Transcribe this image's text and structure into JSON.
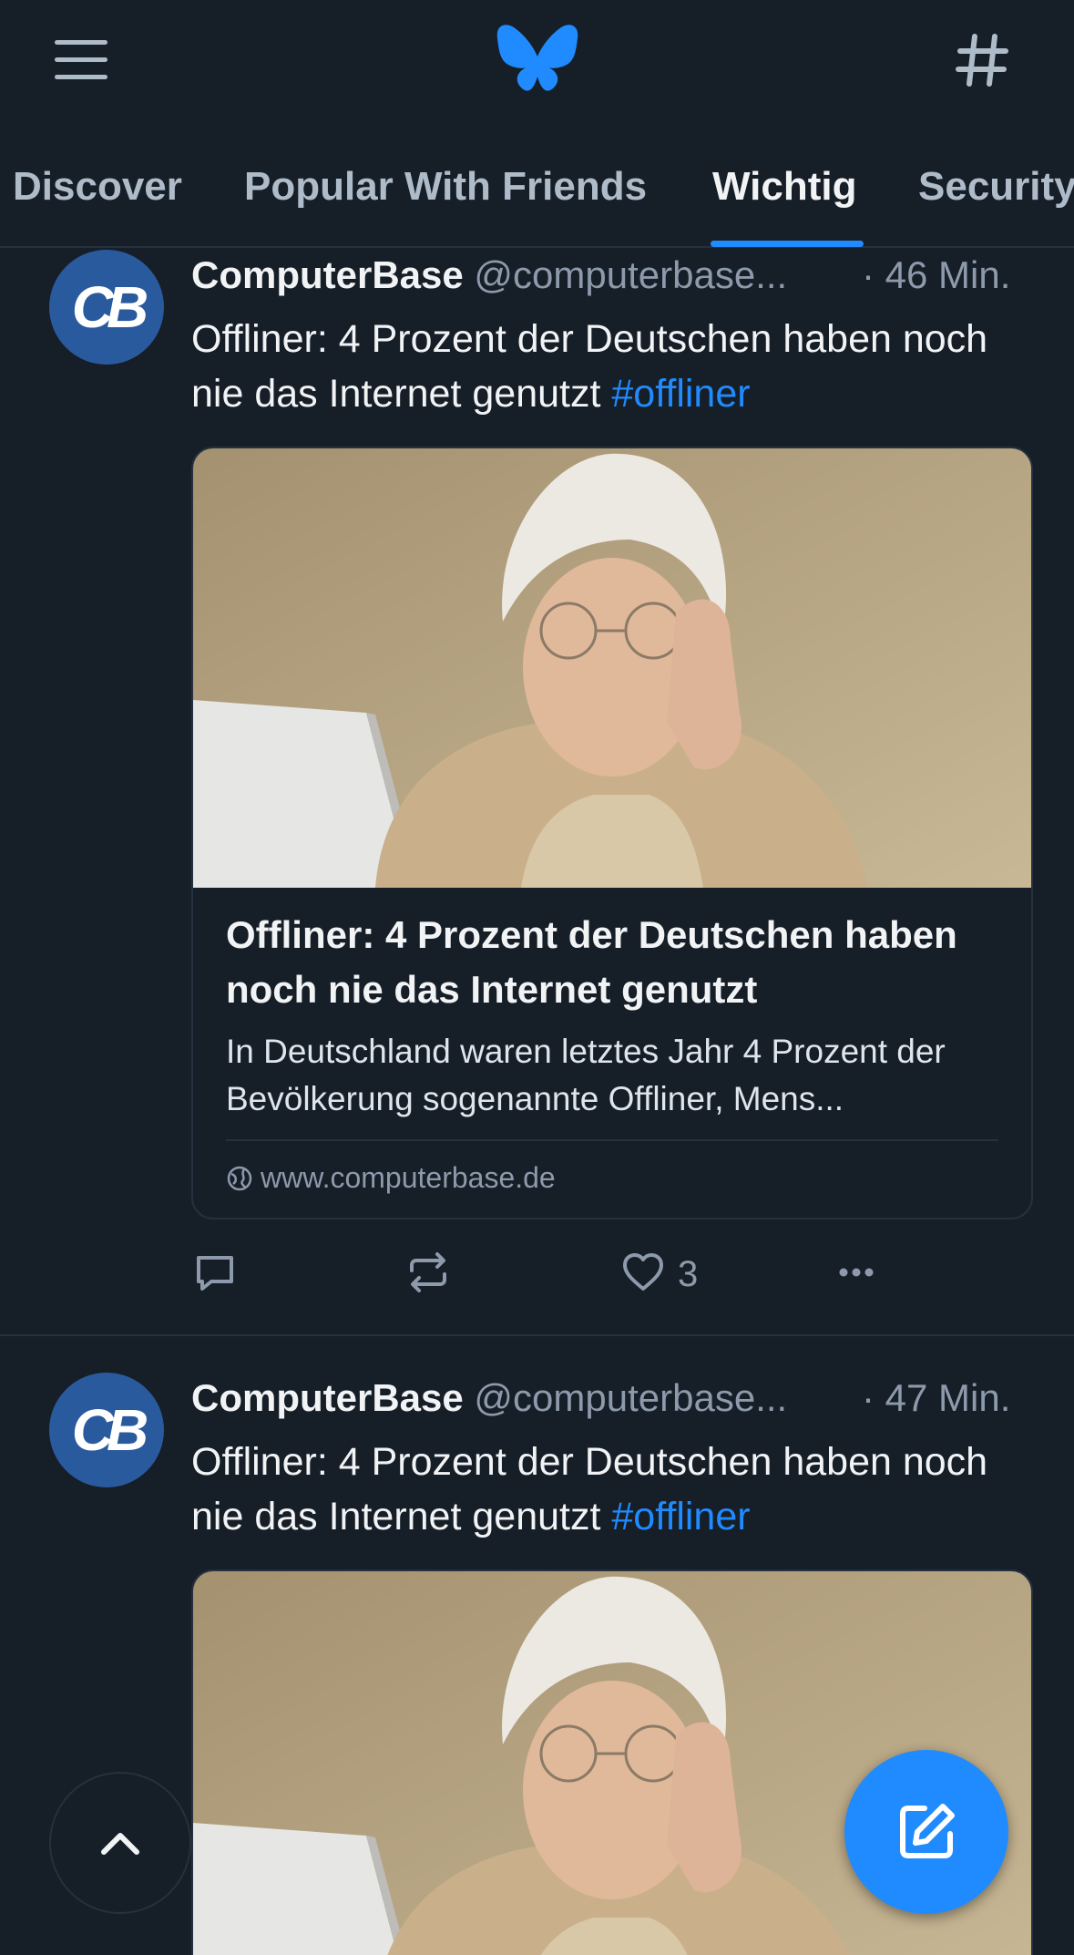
{
  "header": {
    "menu_icon": "hamburger-menu-icon",
    "logo_icon": "butterfly-logo",
    "feeds_icon": "hashtag-icon"
  },
  "tabs": [
    {
      "label": "Discover",
      "active": false
    },
    {
      "label": "Popular With Friends",
      "active": false
    },
    {
      "label": "Wichtig",
      "active": true
    },
    {
      "label": "Security",
      "active": false
    }
  ],
  "colors": {
    "accent": "#208bfe",
    "background": "#161e27",
    "muted_text": "#8d9aab",
    "avatar": "#2a5a9e"
  },
  "posts": [
    {
      "avatar_text": "CB",
      "author": "ComputerBase",
      "handle": "@computerbase...",
      "time": "· 46 Min.",
      "text": "Offliner: 4 Prozent der Deutschen haben noch nie das Internet genutzt",
      "hashtag": "#offliner",
      "card": {
        "title": "Offliner: 4 Prozent der Deutschen haben noch nie das Internet genutzt",
        "description": "In Deutschland waren letztes Jahr 4 Prozent der Bevölkerung sogenannte Offliner, Mens...",
        "domain": "www.computerbase.de"
      },
      "actions": {
        "reply_count": "",
        "repost_count": "",
        "like_count": "3"
      }
    },
    {
      "avatar_text": "CB",
      "author": "ComputerBase",
      "handle": "@computerbase...",
      "time": "· 47 Min.",
      "text": "Offliner: 4 Prozent der Deutschen haben noch nie das Internet genutzt",
      "hashtag": "#offliner"
    }
  ],
  "floating": {
    "scroll_top_icon": "chevron-up-icon",
    "compose_icon": "compose-icon"
  }
}
